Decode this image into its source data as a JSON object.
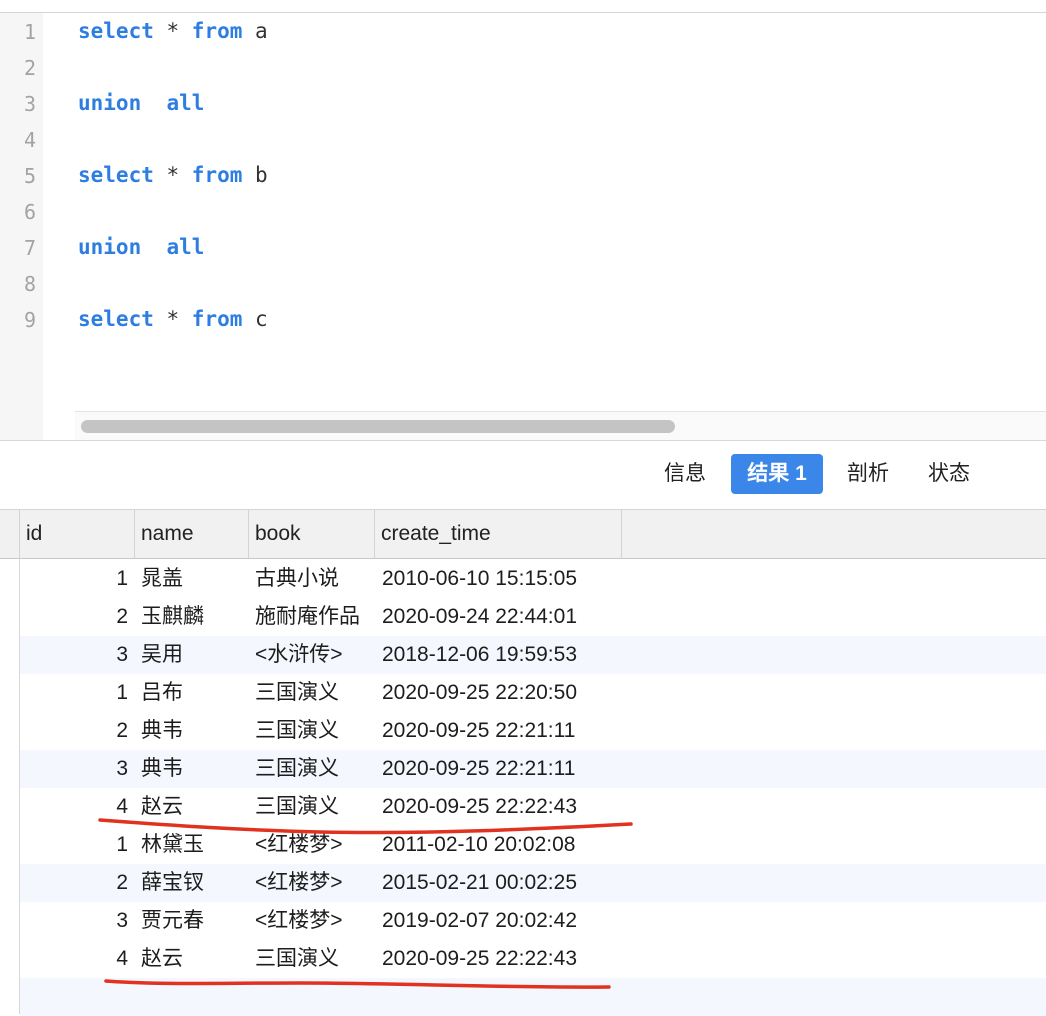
{
  "editor": {
    "lines": [
      {
        "num": "1",
        "tokens": [
          {
            "t": "select",
            "kw": true
          },
          {
            "t": " * ",
            "kw": false
          },
          {
            "t": "from",
            "kw": true
          },
          {
            "t": " a",
            "kw": false
          }
        ]
      },
      {
        "num": "2",
        "tokens": []
      },
      {
        "num": "3",
        "tokens": [
          {
            "t": "union",
            "kw": true
          },
          {
            "t": "  ",
            "kw": false
          },
          {
            "t": "all",
            "kw": true
          }
        ]
      },
      {
        "num": "4",
        "tokens": []
      },
      {
        "num": "5",
        "tokens": [
          {
            "t": "select",
            "kw": true
          },
          {
            "t": " * ",
            "kw": false
          },
          {
            "t": "from",
            "kw": true
          },
          {
            "t": " b",
            "kw": false
          }
        ]
      },
      {
        "num": "6",
        "tokens": []
      },
      {
        "num": "7",
        "tokens": [
          {
            "t": "union",
            "kw": true
          },
          {
            "t": "  ",
            "kw": false
          },
          {
            "t": "all",
            "kw": true
          }
        ]
      },
      {
        "num": "8",
        "tokens": []
      },
      {
        "num": "9",
        "tokens": [
          {
            "t": "select",
            "kw": true
          },
          {
            "t": " * ",
            "kw": false
          },
          {
            "t": "from",
            "kw": true
          },
          {
            "t": " c",
            "kw": false
          }
        ]
      }
    ]
  },
  "tabs": [
    {
      "label": "信息",
      "active": false
    },
    {
      "label": "结果 1",
      "active": true
    },
    {
      "label": "剖析",
      "active": false
    },
    {
      "label": "状态",
      "active": false
    }
  ],
  "grid": {
    "columns": [
      "id",
      "name",
      "book",
      "create_time"
    ],
    "rows": [
      [
        "1",
        "晁盖",
        "古典小说",
        "2010-06-10 15:15:05"
      ],
      [
        "2",
        "玉麒麟",
        "施耐庵作品",
        "2020-09-24 22:44:01"
      ],
      [
        "3",
        "吴用",
        "<水浒传>",
        "2018-12-06 19:59:53"
      ],
      [
        "1",
        "吕布",
        "三国演义",
        "2020-09-25 22:20:50"
      ],
      [
        "2",
        "典韦",
        "三国演义",
        "2020-09-25 22:21:11"
      ],
      [
        "3",
        "典韦",
        "三国演义",
        "2020-09-25 22:21:11"
      ],
      [
        "4",
        "赵云",
        "三国演义",
        "2020-09-25 22:22:43"
      ],
      [
        "1",
        "林黛玉",
        "<红楼梦>",
        "2011-02-10 20:02:08"
      ],
      [
        "2",
        "薛宝钗",
        "<红楼梦>",
        "2015-02-21 00:02:25"
      ],
      [
        "3",
        "贾元春",
        "<红楼梦>",
        "2019-02-07 20:02:42"
      ],
      [
        "4",
        "赵云",
        "三国演义",
        "2020-09-25 22:22:43"
      ]
    ]
  },
  "colors": {
    "keyword": "#2d7ee0",
    "active_tab": "#3b86e9",
    "annotation": "#e0321f",
    "row_stripe": "#f4f7fd"
  }
}
